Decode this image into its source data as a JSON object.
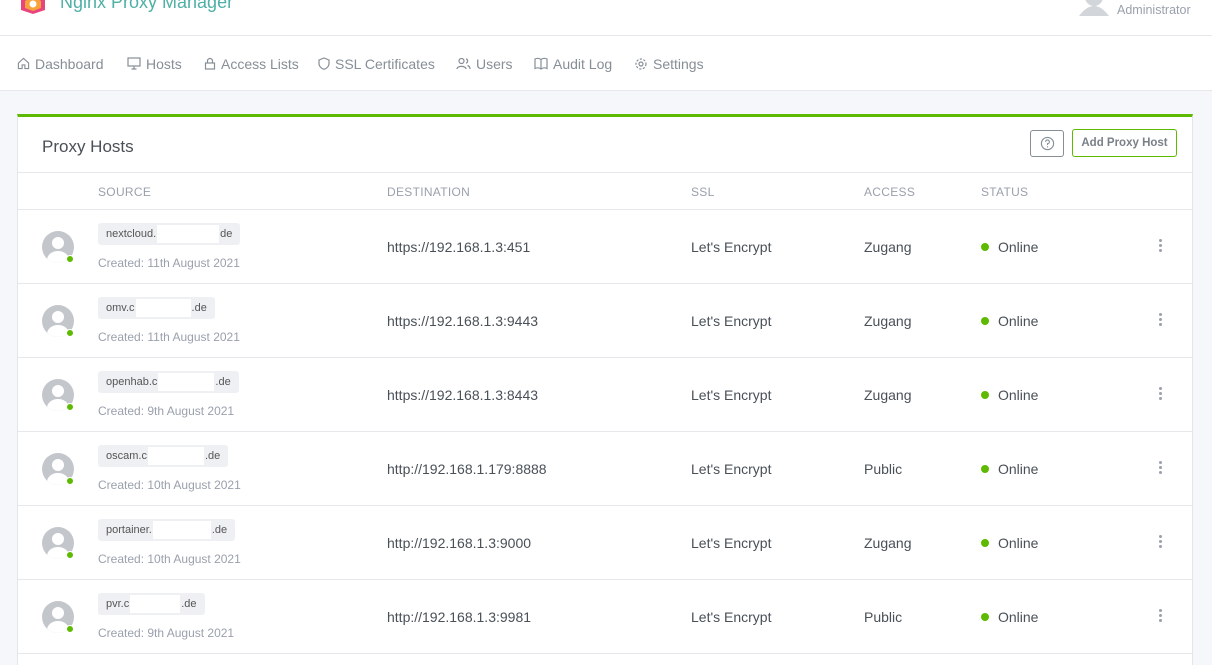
{
  "app": {
    "title": "Nginx Proxy Manager"
  },
  "user": {
    "role": "Administrator"
  },
  "nav": [
    {
      "label": "Dashboard",
      "icon": "home-icon"
    },
    {
      "label": "Hosts",
      "icon": "monitor-icon"
    },
    {
      "label": "Access Lists",
      "icon": "lock-icon"
    },
    {
      "label": "SSL Certificates",
      "icon": "shield-icon"
    },
    {
      "label": "Users",
      "icon": "users-icon"
    },
    {
      "label": "Audit Log",
      "icon": "book-icon"
    },
    {
      "label": "Settings",
      "icon": "gear-icon"
    }
  ],
  "card": {
    "title": "Proxy Hosts",
    "add_label": "Add Proxy Host",
    "help_icon": "help-circle-icon"
  },
  "table": {
    "headers": {
      "source": "SOURCE",
      "destination": "DESTINATION",
      "ssl": "SSL",
      "access": "ACCESS",
      "status": "STATUS"
    },
    "rows": [
      {
        "domain_prefix": "nextcloud.",
        "domain_suffix": "de",
        "created": "Created: 11th August 2021",
        "destination": "https://192.168.1.3:451",
        "ssl": "Let's Encrypt",
        "access": "Zugang",
        "status": "Online"
      },
      {
        "domain_prefix": "omv.c",
        "domain_suffix": ".de",
        "created": "Created: 11th August 2021",
        "destination": "https://192.168.1.3:9443",
        "ssl": "Let's Encrypt",
        "access": "Zugang",
        "status": "Online"
      },
      {
        "domain_prefix": "openhab.c",
        "domain_suffix": ".de",
        "created": "Created: 9th August 2021",
        "destination": "https://192.168.1.3:8443",
        "ssl": "Let's Encrypt",
        "access": "Zugang",
        "status": "Online"
      },
      {
        "domain_prefix": "oscam.c",
        "domain_suffix": ".de",
        "created": "Created: 10th August 2021",
        "destination": "http://192.168.1.179:8888",
        "ssl": "Let's Encrypt",
        "access": "Public",
        "status": "Online"
      },
      {
        "domain_prefix": "portainer.",
        "domain_suffix": ".de",
        "created": "Created: 10th August 2021",
        "destination": "http://192.168.1.3:9000",
        "ssl": "Let's Encrypt",
        "access": "Zugang",
        "status": "Online"
      },
      {
        "domain_prefix": "pvr.c",
        "domain_suffix": ".de",
        "created": "Created: 9th August 2021",
        "destination": "http://192.168.1.3:9981",
        "ssl": "Let's Encrypt",
        "access": "Public",
        "status": "Online"
      }
    ]
  },
  "colors": {
    "accent": "#5eba00",
    "brand_text": "#4fb0a5",
    "online": "#5eba00"
  }
}
